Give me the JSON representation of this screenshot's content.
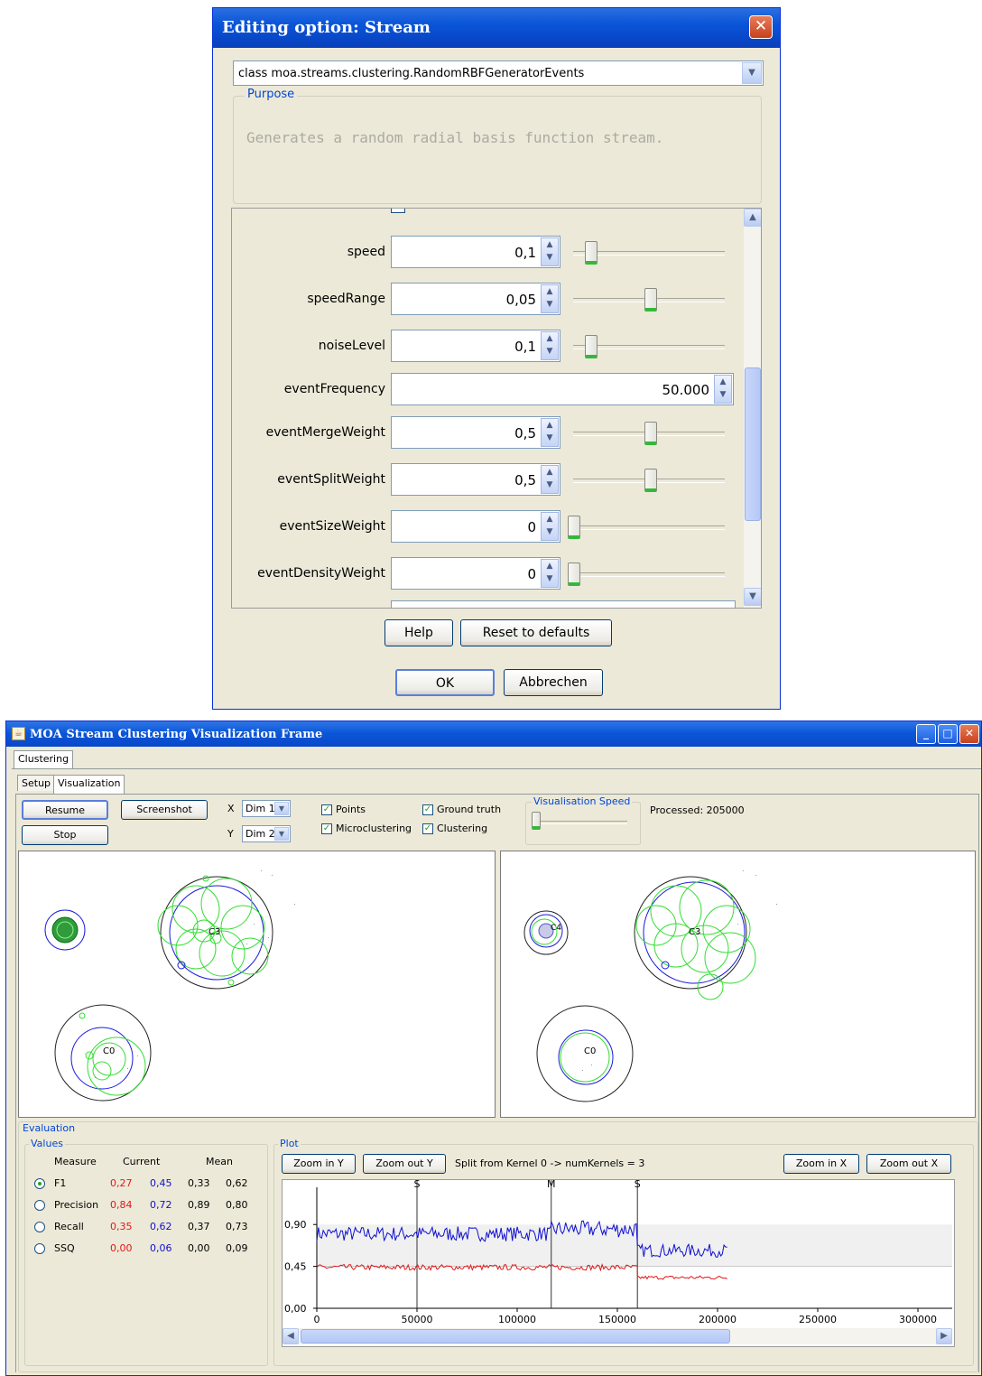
{
  "dialog": {
    "title": "Editing option: Stream",
    "close_glyph": "✕",
    "class_value": "class moa.streams.clustering.RandomRBFGeneratorEvents",
    "purpose_title": "Purpose",
    "purpose_text": "Generates a random radial basis function stream.",
    "options": [
      {
        "label": "speed",
        "value": "0,1",
        "slider": 0.1
      },
      {
        "label": "speedRange",
        "value": "0,05",
        "slider": 0.5
      },
      {
        "label": "noiseLevel",
        "value": "0,1",
        "slider": 0.1
      },
      {
        "label": "eventFrequency",
        "value": "50.000",
        "slider": null
      },
      {
        "label": "eventMergeWeight",
        "value": "0,5",
        "slider": 0.5
      },
      {
        "label": "eventSplitWeight",
        "value": "0,5",
        "slider": 0.5
      },
      {
        "label": "eventSizeWeight",
        "value": "0",
        "slider": 0.0
      },
      {
        "label": "eventDensityWeight",
        "value": "0",
        "slider": 0.0
      }
    ],
    "help_label": "Help",
    "reset_label": "Reset to defaults",
    "ok_label": "OK",
    "cancel_label": "Abbrechen"
  },
  "frame": {
    "title": "MOA Stream Clustering Visualization Frame",
    "tab_clustering": "Clustering",
    "tab_setup": "Setup",
    "tab_visualization": "Visualization",
    "resume_label": "Resume",
    "stop_label": "Stop",
    "screenshot_label": "Screenshot",
    "x_label": "X",
    "y_label": "Y",
    "x_dim": "Dim 1",
    "y_dim": "Dim 2",
    "cb_points": "Points",
    "cb_micro": "Microclustering",
    "cb_ground": "Ground truth",
    "cb_clustering": "Clustering",
    "speed_title": "Visualisation Speed",
    "processed": "Processed: 205000",
    "cluster_labels": {
      "c3": "C3",
      "c0": "C0",
      "c4": "C4"
    }
  },
  "evaluation": {
    "title": "Evaluation",
    "values_title": "Values",
    "headers": [
      "Measure",
      "Current",
      "Mean"
    ],
    "rows": [
      {
        "name": "F1",
        "cur_red": "0,27",
        "cur_blue": "0,45",
        "mean_a": "0,33",
        "mean_b": "0,62",
        "selected": true
      },
      {
        "name": "Precision",
        "cur_red": "0,84",
        "cur_blue": "0,72",
        "mean_a": "0,89",
        "mean_b": "0,80",
        "selected": false
      },
      {
        "name": "Recall",
        "cur_red": "0,35",
        "cur_blue": "0,62",
        "mean_a": "0,37",
        "mean_b": "0,73",
        "selected": false
      },
      {
        "name": "SSQ",
        "cur_red": "0,00",
        "cur_blue": "0,06",
        "mean_a": "0,00",
        "mean_b": "0,09",
        "selected": false
      }
    ],
    "plot_title": "Plot",
    "zoom_in_y": "Zoom in Y",
    "zoom_out_y": "Zoom out Y",
    "zoom_in_x": "Zoom in X",
    "zoom_out_x": "Zoom out X",
    "split_text": "Split from Kernel 0 -> numKernels = 3"
  },
  "chart_data": {
    "type": "line",
    "x_ticks": [
      "0",
      "50000",
      "100000",
      "150000",
      "200000",
      "250000",
      "300000"
    ],
    "y_ticks": [
      "0,00",
      "0,45",
      "0,90"
    ],
    "xlim": [
      0,
      330000
    ],
    "ylim": [
      0,
      1.3
    ],
    "events": [
      {
        "label": "S",
        "x": 50000
      },
      {
        "label": "M",
        "x": 117000
      },
      {
        "label": "S",
        "x": 160000
      }
    ],
    "series": [
      {
        "color": "#1010d0",
        "segments": [
          {
            "from": 0,
            "to": 117000,
            "base": 0.8,
            "amp": 0.08
          },
          {
            "from": 117000,
            "to": 160000,
            "base": 0.85,
            "amp": 0.09
          },
          {
            "from": 160000,
            "to": 205000,
            "base": 0.62,
            "amp": 0.07
          }
        ]
      },
      {
        "color": "#e51616",
        "segments": [
          {
            "from": 0,
            "to": 160000,
            "base": 0.44,
            "amp": 0.03
          },
          {
            "from": 160000,
            "to": 205000,
            "base": 0.33,
            "amp": 0.02
          }
        ]
      }
    ]
  }
}
